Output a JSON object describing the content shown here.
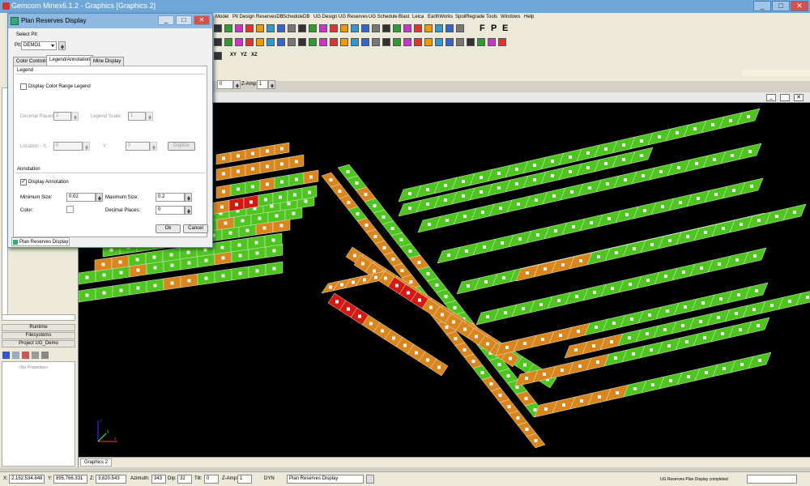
{
  "app": {
    "title": "Gemcom Minex6.1.2 - Graphics [Graphics 2]",
    "window_controls": [
      "_",
      "□",
      "✕"
    ]
  },
  "menu": [
    "Model",
    "Pit Design",
    "ReservesDB",
    "ScheduleDB",
    "UG Design",
    "UG Reserves",
    "UG Schedule",
    "Blast",
    "Leica",
    "EarthWorks",
    "SpoilRegrade",
    "Tools",
    "Windows",
    "Help"
  ],
  "toolbar": {
    "text_buttons": [
      "F",
      "P",
      "E"
    ],
    "xy_buttons": [
      "XY",
      "YZ",
      "XZ"
    ],
    "view_field": "0",
    "zamp_label": "Z-Amp:",
    "zamp_value": "1"
  },
  "dialog": {
    "title": "Plan Reserves Display",
    "select_pit_label": "Select Pit:",
    "pit_label": "Pit:",
    "pit_value": "DEMO1",
    "tabs": [
      "Color Controls",
      "Legend/Annotation",
      "Mine Display"
    ],
    "active_tab": "Legend/Annotation",
    "legend": {
      "group": "Legend",
      "display_color_range_label": "Display Color Range Legend",
      "display_color_range_checked": false,
      "decimal_places_label": "Decimal Places:",
      "decimal_places_value": "2",
      "legend_scale_label": "Legend Scale:",
      "legend_scale_value": "1",
      "location_x_label": "Location - X:",
      "location_x_value": "0",
      "y_label": "Y:",
      "y_value": "0",
      "digitize_label": "Digitize"
    },
    "annotation": {
      "group": "Annotation",
      "display_annotation_label": "Display Annotation",
      "display_annotation_checked": true,
      "min_size_label": "Minimum Size:",
      "min_size_value": "0.02",
      "max_size_label": "Maximum Size:",
      "max_size_value": "0.2",
      "color_label": "Color:",
      "decimal_places_label": "Decimal Places:",
      "decimal_places_value": "0"
    },
    "ok_label": "Ok",
    "cancel_label": "Cancel",
    "footer_tab": "Plan Reserves Display"
  },
  "left_panel": {
    "items": [
      "Runtime",
      "Filesystems",
      "Project UG_Demo"
    ],
    "no_properties": "<No Properties>"
  },
  "graphics_tab": "Graphics 2",
  "status": {
    "x_label": "X:",
    "x_value": "2,152,534.848",
    "y_label": "Y:",
    "y_value": "895,766.331",
    "z_label": "Z:",
    "z_value": "3,820.543",
    "azimuth_label": "Azimuth:",
    "azimuth_value": "343",
    "dip_label": "Dip:",
    "dip_value": "32",
    "tilt_label": "Tilt:",
    "tilt_value": "0",
    "zamp_label": "Z-Amp:",
    "zamp_value": "1",
    "dyn_label": "DYN",
    "mode_value": "Plan Reserves Display",
    "message": "UG Reserves Plan Display completed"
  },
  "colors": {
    "green": "#4fc520",
    "orange": "#d9861c",
    "red": "#d21a12",
    "viewport_bg": "#000000"
  }
}
